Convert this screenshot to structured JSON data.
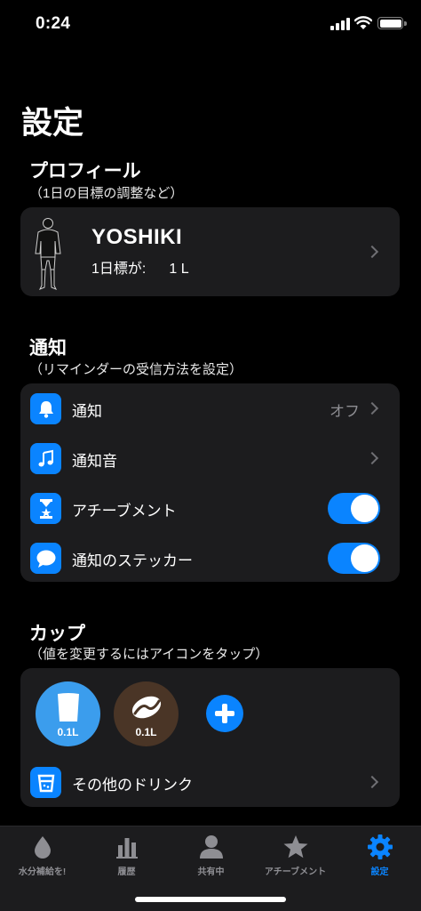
{
  "status_bar": {
    "time": "0:24"
  },
  "page": {
    "title": "設定"
  },
  "profile_section": {
    "title": "プロフィール",
    "subtitle": "（1日の目標の調整など）",
    "name": "YOSHIKI",
    "goal_label": "1日標が:",
    "goal_value": "1 L"
  },
  "notification_section": {
    "title": "通知",
    "subtitle": "（リマインダーの受信方法を設定）",
    "rows": [
      {
        "label": "通知",
        "value": "オフ",
        "icon": "bell-icon"
      },
      {
        "label": "通知音",
        "icon": "music-note-icon"
      },
      {
        "label": "アチーブメント",
        "icon": "hourglass-star-icon",
        "toggle": "on"
      },
      {
        "label": "通知のステッカー",
        "icon": "speech-bubble-icon",
        "toggle": "on"
      }
    ]
  },
  "cup_section": {
    "title": "カップ",
    "subtitle": "（値を変更するにはアイコンをタップ）",
    "cups": [
      {
        "label": "0.1L",
        "icon": "glass-icon",
        "color": "#3b9ded"
      },
      {
        "label": "0.1L",
        "icon": "coffee-bean-icon",
        "color": "#4a3526"
      }
    ],
    "other_drinks_label": "その他のドリンク"
  },
  "tab_bar": {
    "tabs": [
      {
        "label": "水分補給を!",
        "icon": "water-drop-icon",
        "active": false
      },
      {
        "label": "履歴",
        "icon": "bar-chart-icon",
        "active": false
      },
      {
        "label": "共有中",
        "icon": "person-icon",
        "active": false
      },
      {
        "label": "アチーブメント",
        "icon": "star-icon",
        "active": false
      },
      {
        "label": "設定",
        "icon": "gear-icon",
        "active": true
      }
    ]
  },
  "colors": {
    "accent": "#0a84ff",
    "card": "#1c1c1e",
    "background": "#000000"
  }
}
